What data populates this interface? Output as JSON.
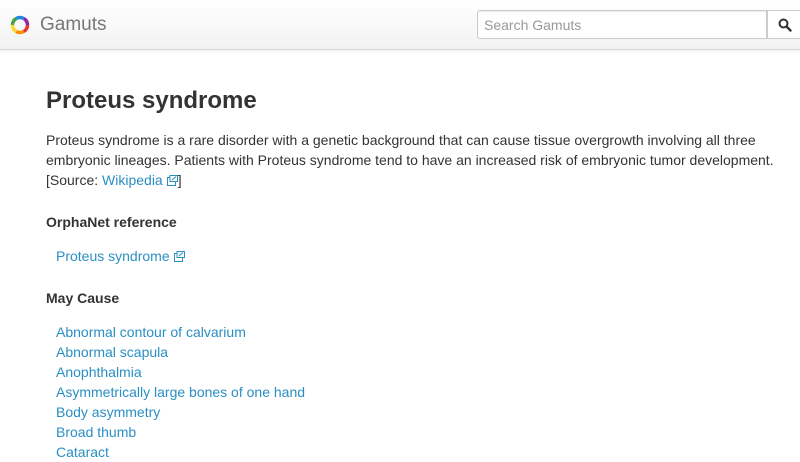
{
  "header": {
    "brand_name": "Gamuts",
    "search_placeholder": "Search Gamuts",
    "search_button_icon": "search-icon"
  },
  "main": {
    "title": "Proteus syndrome",
    "description_text": "Proteus syndrome is a rare disorder with a genetic background that can cause tissue overgrowth involving all three embryonic lineages. Patients with Proteus syndrome tend to have an increased risk of embryonic tumor development. [Source: ",
    "source_link": "Wikipedia",
    "description_end": "]",
    "orphanet_heading": "OrphaNet reference",
    "orphanet_items": [
      "Proteus syndrome"
    ],
    "may_cause_heading": "May Cause",
    "may_cause_items": [
      "Abnormal contour of calvarium",
      "Abnormal scapula",
      "Anophthalmia",
      "Asymmetrically large bones of one hand",
      "Body asymmetry",
      "Broad thumb",
      "Cataract"
    ]
  },
  "colors": {
    "link": "#2a8fc4",
    "text": "#333333",
    "brand": "#777777"
  }
}
